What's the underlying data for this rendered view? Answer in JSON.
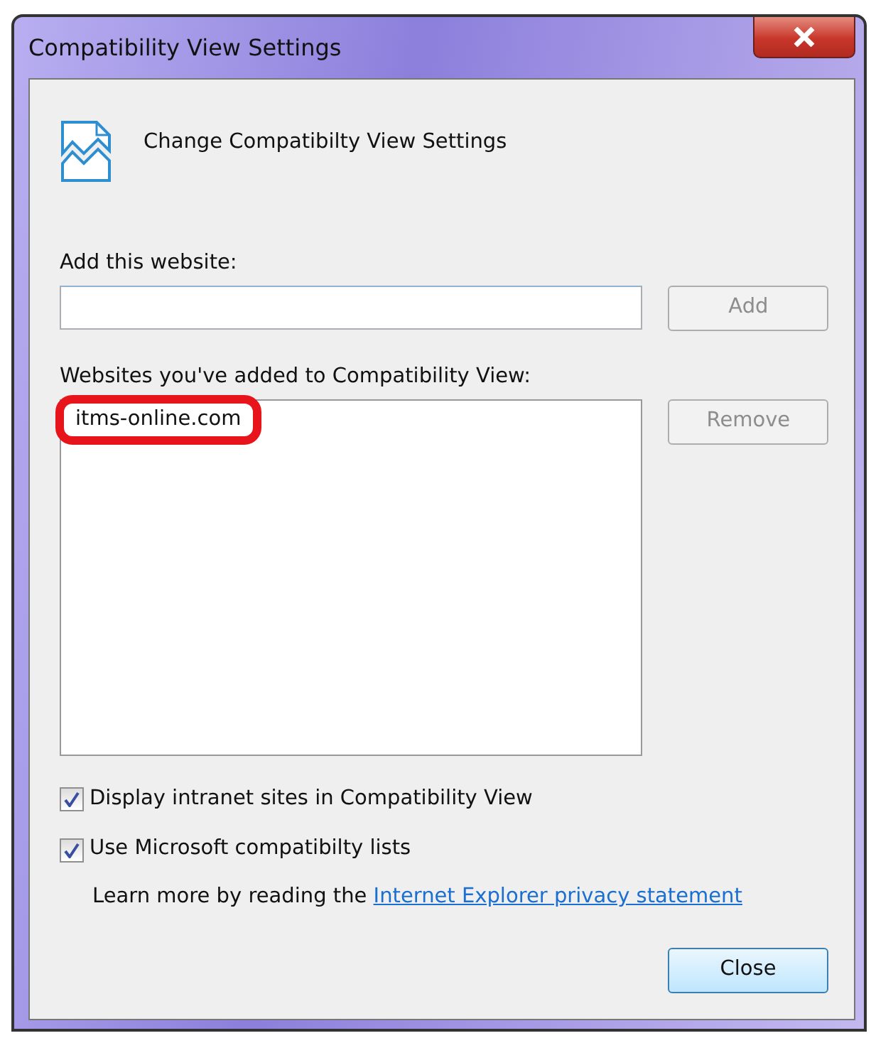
{
  "window": {
    "title": "Compatibility View Settings"
  },
  "header": {
    "text": "Change Compatibilty View Settings"
  },
  "add_field": {
    "label": "Add this website:"
  },
  "add_button": {
    "label": "Add",
    "disabled": true
  },
  "websites": {
    "label": "Websites you've added to Compatibility View:",
    "items": [
      {
        "text": "itms-online.com",
        "selected": false,
        "highlighted": true
      }
    ]
  },
  "remove_button": {
    "label": "Remove",
    "disabled": true
  },
  "checkboxes": [
    {
      "label": "Display intranet sites in Compatibility View",
      "checked": true
    },
    {
      "label": "Use Microsoft compatibilty lists",
      "checked": true
    }
  ],
  "privacy": {
    "text": "Learn more by reading the",
    "link": "Internet Explorer privacy statement"
  },
  "close_button": {
    "label": "Close",
    "disabled": false
  }
}
